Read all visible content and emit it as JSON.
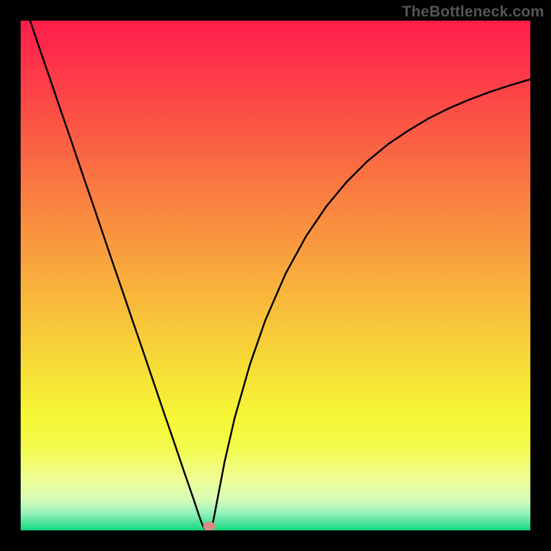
{
  "watermark": "TheBottleneck.com",
  "chart_data": {
    "type": "line",
    "title": "",
    "xlabel": "",
    "ylabel": "",
    "xlim": [
      0,
      1
    ],
    "ylim": [
      0,
      1
    ],
    "x": [
      0.0,
      0.02,
      0.04,
      0.06,
      0.08,
      0.1,
      0.12,
      0.14,
      0.16,
      0.18,
      0.2,
      0.22,
      0.24,
      0.26,
      0.28,
      0.3,
      0.32,
      0.33,
      0.34,
      0.35,
      0.355,
      0.36,
      0.365,
      0.37,
      0.375,
      0.38,
      0.4,
      0.42,
      0.45,
      0.48,
      0.52,
      0.56,
      0.6,
      0.64,
      0.68,
      0.72,
      0.76,
      0.8,
      0.84,
      0.88,
      0.92,
      0.96,
      1.0
    ],
    "y": [
      1.055,
      0.996,
      0.937,
      0.879,
      0.82,
      0.762,
      0.703,
      0.645,
      0.586,
      0.527,
      0.469,
      0.41,
      0.352,
      0.293,
      0.234,
      0.176,
      0.117,
      0.088,
      0.059,
      0.029,
      0.015,
      0.004,
      0.004,
      0.004,
      0.004,
      0.029,
      0.134,
      0.221,
      0.326,
      0.412,
      0.504,
      0.577,
      0.636,
      0.684,
      0.724,
      0.757,
      0.784,
      0.808,
      0.828,
      0.845,
      0.86,
      0.873,
      0.885
    ],
    "marker": {
      "x": 0.37,
      "y": 0.008,
      "rx": 0.012,
      "ry": 0.009,
      "color": "#d98c86"
    },
    "gradient": {
      "stops": [
        {
          "offset": 0.0,
          "color": "#fd1d4a"
        },
        {
          "offset": 0.1,
          "color": "#fd3748"
        },
        {
          "offset": 0.2,
          "color": "#fb5545"
        },
        {
          "offset": 0.3,
          "color": "#fa7242"
        },
        {
          "offset": 0.4,
          "color": "#f98f3f"
        },
        {
          "offset": 0.5,
          "color": "#f8ab3c"
        },
        {
          "offset": 0.6,
          "color": "#f7c739"
        },
        {
          "offset": 0.7,
          "color": "#f6e236"
        },
        {
          "offset": 0.78,
          "color": "#f5f835"
        },
        {
          "offset": 0.84,
          "color": "#f3fb4f"
        },
        {
          "offset": 0.9,
          "color": "#eefe95"
        },
        {
          "offset": 0.94,
          "color": "#d6fcb8"
        },
        {
          "offset": 0.965,
          "color": "#99f2bb"
        },
        {
          "offset": 0.985,
          "color": "#4de39b"
        },
        {
          "offset": 1.0,
          "color": "#13da81"
        }
      ]
    }
  }
}
